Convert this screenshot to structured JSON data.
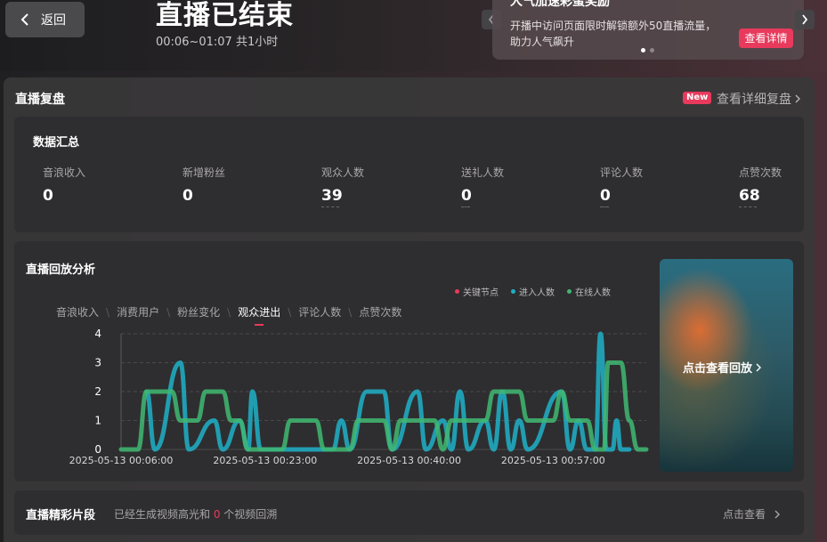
{
  "header": {
    "back_label": "返回",
    "title": "直播已结束",
    "subtitle": "00:06~01:07 共1小时"
  },
  "promo": {
    "title": "人气加速彩蛋奖励",
    "desc": "开播中访问页面限时解锁额外50直播流量，助力人气飙升",
    "button": "查看详情",
    "slides_total": 2,
    "slide_active": 1
  },
  "review": {
    "title": "直播复盘",
    "badge": "New",
    "detail_link": "查看详细复盘"
  },
  "summary": {
    "title": "数据汇总",
    "metrics": [
      {
        "label": "音浪收入",
        "value": "0"
      },
      {
        "label": "新增粉丝",
        "value": "0"
      },
      {
        "label": "观众人数",
        "value": "39"
      },
      {
        "label": "送礼人数",
        "value": "0"
      },
      {
        "label": "评论人数",
        "value": "0"
      },
      {
        "label": "点赞次数",
        "value": "68"
      }
    ]
  },
  "analysis": {
    "title": "直播回放分析",
    "legend": [
      {
        "label": "关键节点",
        "color": "#e83a5c"
      },
      {
        "label": "进入人数",
        "color": "#1fb0c8"
      },
      {
        "label": "在线人数",
        "color": "#3fb872"
      }
    ],
    "tabs": [
      "音浪收入",
      "消费用户",
      "粉丝变化",
      "观众进出",
      "评论人数",
      "点赞次数"
    ],
    "active_tab": "观众进出",
    "replay_label": "点击查看回放"
  },
  "chart_data": {
    "type": "line",
    "xlabel": "",
    "ylabel": "",
    "ylim": [
      0,
      4
    ],
    "yticks": [
      0,
      1,
      2,
      3,
      4
    ],
    "x_tick_labels": [
      "2025-05-13 00:06:00",
      "2025-05-13 00:23:00",
      "2025-05-13 00:40:00",
      "2025-05-13 00:57:00"
    ],
    "x_start_minute": 6,
    "x_end_minute": 68,
    "grid": true,
    "series": [
      {
        "name": "进入人数",
        "color": "#1fb0c8",
        "points": [
          [
            9,
            2
          ],
          [
            10,
            0
          ],
          [
            13,
            3
          ],
          [
            14,
            0
          ],
          [
            17,
            1
          ],
          [
            18,
            0
          ],
          [
            20,
            1
          ],
          [
            21,
            0
          ],
          [
            21.5,
            2
          ],
          [
            22.5,
            0
          ],
          [
            25,
            0
          ],
          [
            31,
            0
          ],
          [
            32,
            1
          ],
          [
            33,
            0
          ],
          [
            35,
            2
          ],
          [
            37,
            2
          ],
          [
            38,
            0
          ],
          [
            41,
            2
          ],
          [
            42,
            0
          ],
          [
            44,
            1
          ],
          [
            45,
            0
          ],
          [
            46,
            2
          ],
          [
            47,
            0
          ],
          [
            49,
            1
          ],
          [
            50,
            0
          ],
          [
            51,
            2
          ],
          [
            52,
            0
          ],
          [
            53,
            1
          ],
          [
            54,
            0
          ],
          [
            58,
            2
          ],
          [
            59,
            0
          ],
          [
            60,
            1
          ],
          [
            61,
            0
          ],
          [
            62,
            0
          ],
          [
            62.6,
            4
          ],
          [
            63.3,
            0
          ],
          [
            64,
            0
          ],
          [
            64.5,
            1
          ],
          [
            65,
            0
          ],
          [
            66,
            0
          ]
        ]
      },
      {
        "name": "在线人数",
        "color": "#3fb872",
        "points": [
          [
            6,
            0
          ],
          [
            8,
            0
          ],
          [
            9,
            2
          ],
          [
            12,
            2
          ],
          [
            13,
            1
          ],
          [
            14,
            1
          ],
          [
            15,
            1
          ],
          [
            16,
            2
          ],
          [
            18,
            2
          ],
          [
            19,
            1
          ],
          [
            20,
            1
          ],
          [
            21,
            0
          ],
          [
            25,
            0
          ],
          [
            26,
            1
          ],
          [
            29,
            1
          ],
          [
            30,
            0
          ],
          [
            33,
            0
          ],
          [
            34,
            1
          ],
          [
            37,
            1
          ],
          [
            38,
            0
          ],
          [
            39,
            1
          ],
          [
            43,
            1
          ],
          [
            44,
            0
          ],
          [
            45,
            1
          ],
          [
            49,
            1
          ],
          [
            50,
            2
          ],
          [
            53,
            2
          ],
          [
            54,
            1
          ],
          [
            57,
            1
          ],
          [
            58,
            2
          ],
          [
            59,
            1
          ],
          [
            61,
            1
          ],
          [
            62,
            0
          ],
          [
            63,
            0
          ],
          [
            63.5,
            3
          ],
          [
            65,
            3
          ],
          [
            66,
            1
          ],
          [
            67,
            0
          ],
          [
            68,
            0
          ]
        ]
      }
    ]
  }
}
